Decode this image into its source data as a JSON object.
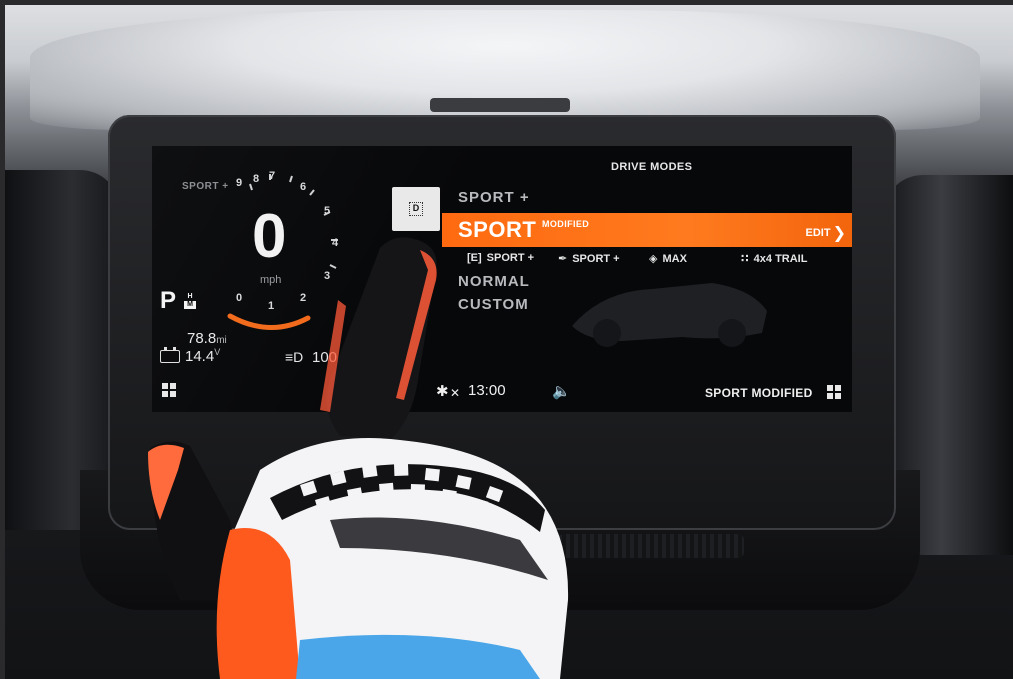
{
  "cluster": {
    "mode_small": "SPORT +",
    "tach_numbers": [
      "9",
      "8",
      "7",
      "6",
      "5",
      "4",
      "3",
      "2",
      "1",
      "0"
    ],
    "speed": "0",
    "speed_unit": "mph",
    "gear": "P",
    "gear_sub": [
      "H",
      "M"
    ],
    "odometer": "78.8",
    "odometer_unit": "mi",
    "voltage": "14.4",
    "voltage_unit": "V",
    "lights_value": "100"
  },
  "drive_modes": {
    "title": "DRIVE MODES",
    "d_button": "D",
    "items": [
      {
        "label": "SPORT +"
      },
      {
        "label": "NORMAL"
      },
      {
        "label": "CUSTOM"
      }
    ],
    "selected": {
      "label": "SPORT",
      "modifier": "MODIFIED",
      "action": "EDIT"
    },
    "options": [
      {
        "label": "SPORT +",
        "icon": "E"
      },
      {
        "label": "SPORT +",
        "icon": "wrench"
      },
      {
        "label": "MAX",
        "icon": "steering"
      },
      {
        "label": "4x4 TRAIL",
        "icon": "4x4"
      }
    ]
  },
  "status_bar": {
    "bluetooth": "✕",
    "time": "13:00",
    "current_mode": "SPORT MODIFIED"
  },
  "colors": {
    "accent": "#ff6a10",
    "screen_bg": "#07080a",
    "text": "#e8e8e8"
  }
}
